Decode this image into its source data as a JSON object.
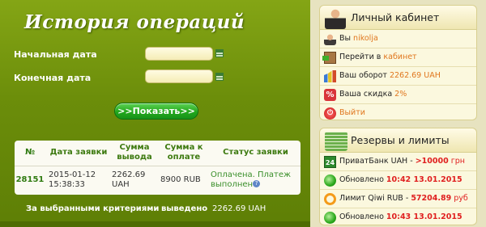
{
  "history": {
    "title": "История операций",
    "start_label": "Начальная дата",
    "end_label": "Конечная дата",
    "start_value": "",
    "end_value": "",
    "show_button": ">>Показать>>",
    "columns": [
      "№",
      "Дата заявки",
      "Сумма вывода",
      "Сумма к оплате",
      "Статус заявки"
    ],
    "rows": [
      {
        "id": "28151",
        "date": "2015-01-12 15:38:33",
        "withdraw": "2262.69 UAH",
        "pay": "8900 RUB",
        "status": "Оплачена. Платеж выполнен"
      }
    ],
    "summary_label": "За выбранными критериями",
    "summary_mid": "выведено",
    "summary_value": "2262.69 UAH"
  },
  "cabinet": {
    "title": "Личный кабинет",
    "you_prefix": "Вы ",
    "username": "nikolja",
    "goto_prefix": "Перейти в ",
    "goto_link": "кабинет",
    "turnover_prefix": "Ваш оборот ",
    "turnover_value": "2262.69 UAH",
    "discount_prefix": "Ваша скидка ",
    "discount_value": "2%",
    "logout": "Выйти"
  },
  "reserves": {
    "title": "Резервы и лимиты",
    "privat_prefix": "ПриватБанк UAH - ",
    "privat_value": ">10000",
    "privat_unit": " грн",
    "updated1_prefix": "Обновлено ",
    "updated1_value": "10:42 13.01.2015",
    "qiwi_prefix": "Лимит Qiwi RUB - ",
    "qiwi_value": "57204.89",
    "qiwi_unit": " руб",
    "updated2_prefix": "Обновлено ",
    "updated2_value": "10:43 13.01.2015"
  }
}
